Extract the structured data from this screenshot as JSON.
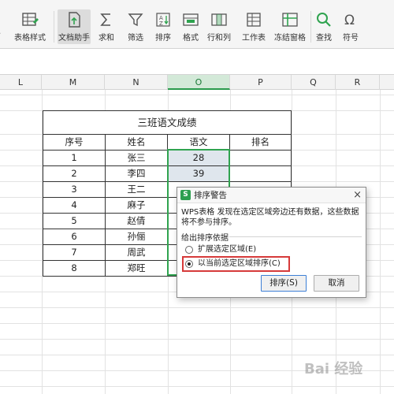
{
  "ribbon": {
    "items": [
      {
        "label": "表格样式",
        "icon": "table-style-icon"
      },
      {
        "label": "文档助手",
        "icon": "doc-assistant-icon",
        "active": true
      },
      {
        "label": "求和",
        "icon": "sum-icon"
      },
      {
        "label": "筛选",
        "icon": "filter-icon"
      },
      {
        "label": "排序",
        "icon": "sort-icon"
      },
      {
        "label": "格式",
        "icon": "format-icon"
      },
      {
        "label": "行和列",
        "icon": "rows-cols-icon"
      },
      {
        "label": "工作表",
        "icon": "worksheet-icon"
      },
      {
        "label": "冻结窗格",
        "icon": "freeze-panes-icon"
      },
      {
        "label": "查找",
        "icon": "find-icon"
      },
      {
        "label": "符号",
        "icon": "symbol-icon"
      }
    ]
  },
  "columns": [
    "L",
    "M",
    "N",
    "O",
    "P",
    "Q",
    "R"
  ],
  "table": {
    "title": "三班语文成绩",
    "headers": [
      "序号",
      "姓名",
      "语文",
      "排名"
    ],
    "rows": [
      {
        "no": "1",
        "name": "张三",
        "score": "28",
        "rank": ""
      },
      {
        "no": "2",
        "name": "李四",
        "score": "39",
        "rank": ""
      },
      {
        "no": "3",
        "name": "王二",
        "score": "",
        "rank": ""
      },
      {
        "no": "4",
        "name": "麻子",
        "score": "",
        "rank": ""
      },
      {
        "no": "5",
        "name": "赵倩",
        "score": "",
        "rank": ""
      },
      {
        "no": "6",
        "name": "孙俪",
        "score": "",
        "rank": ""
      },
      {
        "no": "7",
        "name": "周武",
        "score": "",
        "rank": ""
      },
      {
        "no": "8",
        "name": "郑旺",
        "score": "",
        "rank": ""
      }
    ]
  },
  "dialog": {
    "title": "排序警告",
    "logo": "S",
    "close": "×",
    "message": "WPS表格 发现在选定区域旁边还有数据，这些数据将不参与排序。",
    "group_label": "给出排序依据",
    "options": [
      {
        "label": "扩展选定区域(E)",
        "selected": false
      },
      {
        "label": "以当前选定区域排序(C)",
        "selected": true
      }
    ],
    "sort_button": "排序(S)",
    "cancel_button": "取消"
  },
  "watermark": "Bai 经验",
  "colors": {
    "accent_green": "#2fa34f",
    "highlight_red": "#d63a3a",
    "selected_column_bg": "#d3e9d8"
  }
}
